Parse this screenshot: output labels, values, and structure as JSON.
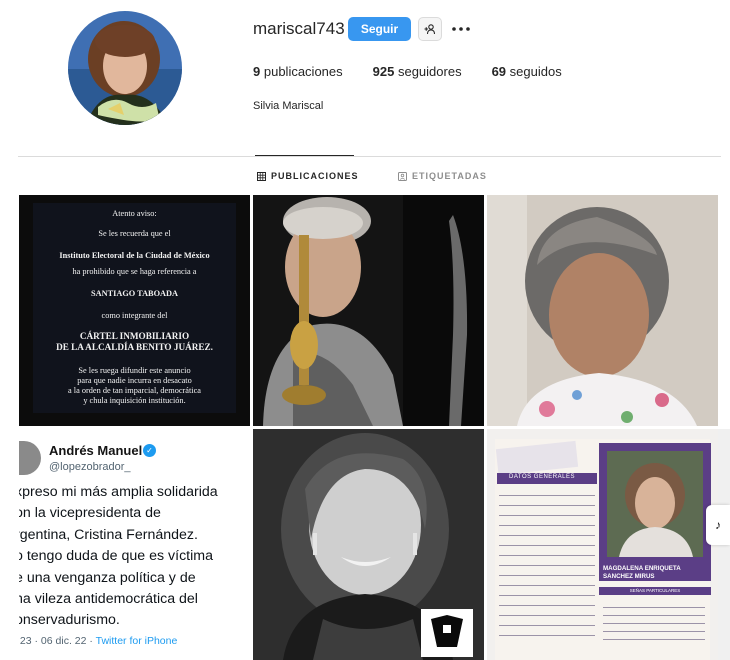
{
  "profile": {
    "username": "mariscal743",
    "follow_label": "Seguir",
    "suggest_icon": "person-plus-icon",
    "more_icon": "ellipsis-icon",
    "full_name": "Silvia Mariscal",
    "stats": {
      "posts_count": "9",
      "posts_label": "publicaciones",
      "followers_count": "925",
      "followers_label": "seguidores",
      "following_count": "69",
      "following_label": "seguidos"
    }
  },
  "tabs": [
    {
      "label": "PUBLICACIONES",
      "icon": "grid-icon",
      "active": true
    },
    {
      "label": "ETIQUETADAS",
      "icon": "tag-icon",
      "active": false
    }
  ],
  "posts": {
    "notice": {
      "line1": "Atento aviso:",
      "line2": "Se les recuerda que el",
      "line3": "Instituto Electoral de la Ciudad de México",
      "line4": "ha prohibido que se haga referencia a",
      "line5": "SANTIAGO TABOADA",
      "line6": "como integrante del",
      "line7": "CÁRTEL INMOBILIARIO",
      "line8": "DE LA ALCALDÍA BENITO JUÁREZ.",
      "line9": "Se les ruega difundir este anuncio",
      "line10": "para que nadie incurra en desacato",
      "line11": "a la orden de tan imparcial, democrática",
      "line12": "y chula inquisición institución."
    },
    "tweet": {
      "name": "Andrés Manuel",
      "handle": "@lopezobrador_",
      "lines": [
        "xpreso mi más amplia solidarida",
        "on la vicepresidenta de",
        "rgentina, Cristina Fernández.",
        "o tengo duda de que es víctima",
        "e una venganza política y de",
        "na vileza antidemocrática del",
        "onservadurismo."
      ],
      "time": ":23 · 06 dic. 22 · ",
      "source": "Twitter for iPhone"
    },
    "document": {
      "section_label": "DATOS GENERALES",
      "person_name": "MAGDALENA ENRIQUETA SANCHEZ MIRUS",
      "sub_label": "SEÑAS PARTICULARES"
    }
  }
}
